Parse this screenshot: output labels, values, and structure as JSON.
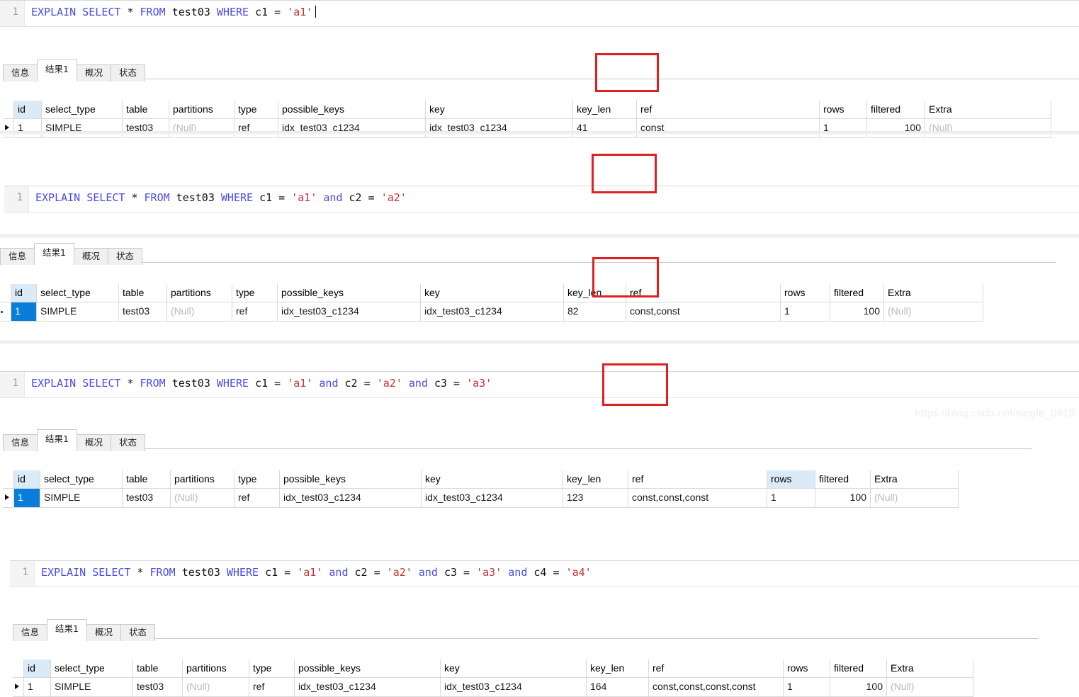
{
  "watermark": "https://blog.csdn.net/single_0910",
  "tabs": [
    {
      "label": "信息",
      "active": false
    },
    {
      "label": "结果1",
      "active": true
    },
    {
      "label": "概况",
      "active": false
    },
    {
      "label": "状态",
      "active": false
    }
  ],
  "columns": [
    "id",
    "select_type",
    "table",
    "partitions",
    "type",
    "possible_keys",
    "key",
    "key_len",
    "ref",
    "rows",
    "filtered",
    "Extra"
  ],
  "blocks": [
    {
      "line_number": "1",
      "sql": {
        "full": "EXPLAIN SELECT * FROM test03 WHERE c1 = 'a1'",
        "tokens": [
          {
            "t": "EXPLAIN ",
            "k": "kw"
          },
          {
            "t": "SELECT ",
            "k": "kw"
          },
          {
            "t": "* ",
            "k": "plain"
          },
          {
            "t": "FROM ",
            "k": "kw"
          },
          {
            "t": "test03 ",
            "k": "plain"
          },
          {
            "t": "WHERE ",
            "k": "kw"
          },
          {
            "t": "c1 = ",
            "k": "plain"
          },
          {
            "t": "'a1'",
            "k": "str"
          }
        ]
      },
      "row": {
        "id": "1",
        "select_type": "SIMPLE",
        "table": "test03",
        "partitions": "(Null)",
        "type": "ref",
        "possible_keys": "idx_test03_c1234",
        "key": "idx_test03_c1234",
        "key_len": "41",
        "ref": "const",
        "rows": "1",
        "filtered": "100",
        "Extra": "(Null)"
      }
    },
    {
      "line_number": "1",
      "sql": {
        "full": "EXPLAIN SELECT * FROM test03 WHERE c1 = 'a1' and c2 = 'a2'",
        "tokens": [
          {
            "t": "EXPLAIN ",
            "k": "kw"
          },
          {
            "t": "SELECT ",
            "k": "kw"
          },
          {
            "t": "* ",
            "k": "plain"
          },
          {
            "t": "FROM ",
            "k": "kw"
          },
          {
            "t": "test03 ",
            "k": "plain"
          },
          {
            "t": "WHERE ",
            "k": "kw"
          },
          {
            "t": "c1 = ",
            "k": "plain"
          },
          {
            "t": "'a1'",
            "k": "str"
          },
          {
            "t": " and ",
            "k": "kw"
          },
          {
            "t": "c2 = ",
            "k": "plain"
          },
          {
            "t": "'a2'",
            "k": "str"
          }
        ]
      },
      "row": {
        "id": "1",
        "select_type": "SIMPLE",
        "table": "test03",
        "partitions": "(Null)",
        "type": "ref",
        "possible_keys": "idx_test03_c1234",
        "key": "idx_test03_c1234",
        "key_len": "82",
        "ref": "const,const",
        "rows": "1",
        "filtered": "100",
        "Extra": "(Null)"
      }
    },
    {
      "line_number": "1",
      "sql": {
        "full": "EXPLAIN SELECT * FROM test03 WHERE c1 = 'a1' and c2 = 'a2' and c3 = 'a3'",
        "tokens": [
          {
            "t": "EXPLAIN ",
            "k": "kw"
          },
          {
            "t": "SELECT ",
            "k": "kw"
          },
          {
            "t": "* ",
            "k": "plain"
          },
          {
            "t": "FROM ",
            "k": "kw"
          },
          {
            "t": "test03 ",
            "k": "plain"
          },
          {
            "t": "WHERE ",
            "k": "kw"
          },
          {
            "t": "c1 = ",
            "k": "plain"
          },
          {
            "t": "'a1'",
            "k": "str"
          },
          {
            "t": " and ",
            "k": "kw"
          },
          {
            "t": "c2 = ",
            "k": "plain"
          },
          {
            "t": "'a2'",
            "k": "str"
          },
          {
            "t": " and ",
            "k": "kw"
          },
          {
            "t": "c3 = ",
            "k": "plain"
          },
          {
            "t": "'a3'",
            "k": "str"
          }
        ]
      },
      "row": {
        "id": "1",
        "select_type": "SIMPLE",
        "table": "test03",
        "partitions": "(Null)",
        "type": "ref",
        "possible_keys": "idx_test03_c1234",
        "key": "idx_test03_c1234",
        "key_len": "123",
        "ref": "const,const,const",
        "rows": "1",
        "filtered": "100",
        "Extra": "(Null)"
      }
    },
    {
      "line_number": "1",
      "sql": {
        "full": "EXPLAIN SELECT * FROM test03 WHERE c1 = 'a1' and c2 = 'a2' and c3 = 'a3' and c4 = 'a4'",
        "tokens": [
          {
            "t": "EXPLAIN ",
            "k": "kw"
          },
          {
            "t": "SELECT ",
            "k": "kw"
          },
          {
            "t": "* ",
            "k": "plain"
          },
          {
            "t": "FROM ",
            "k": "kw"
          },
          {
            "t": "test03 ",
            "k": "plain"
          },
          {
            "t": "WHERE ",
            "k": "kw"
          },
          {
            "t": "c1 = ",
            "k": "plain"
          },
          {
            "t": "'a1'",
            "k": "str"
          },
          {
            "t": " and ",
            "k": "kw"
          },
          {
            "t": "c2 = ",
            "k": "plain"
          },
          {
            "t": "'a2'",
            "k": "str"
          },
          {
            "t": " and ",
            "k": "kw"
          },
          {
            "t": "c3 = ",
            "k": "plain"
          },
          {
            "t": "'a3'",
            "k": "str"
          },
          {
            "t": " and ",
            "k": "kw"
          },
          {
            "t": "c4 = ",
            "k": "plain"
          },
          {
            "t": "'a4'",
            "k": "str"
          }
        ]
      },
      "row": {
        "id": "1",
        "select_type": "SIMPLE",
        "table": "test03",
        "partitions": "(Null)",
        "type": "ref",
        "possible_keys": "idx_test03_c1234",
        "key": "idx_test03_c1234",
        "key_len": "164",
        "ref": "const,const,const,const",
        "rows": "1",
        "filtered": "100",
        "Extra": "(Null)"
      }
    }
  ],
  "highlight_color": "#e02020",
  "selection_color": "#0a7ddb",
  "header_tint_color": "#dbeaf7"
}
